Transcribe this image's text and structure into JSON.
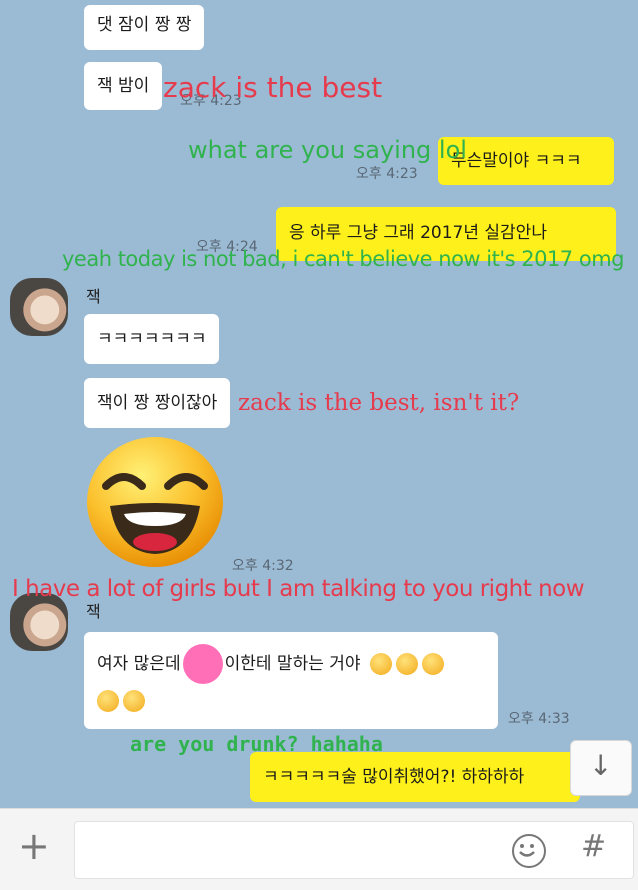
{
  "messages": [
    {
      "text": "댓 잠이 짱 짱"
    },
    {
      "text": "잭 밤이"
    },
    {
      "text": "무슨말이야 ㅋㅋㅋ"
    },
    {
      "text": "응 하루 그냥 그래 2017년 실감안나"
    },
    {
      "text": "ㅋㅋㅋㅋㅋㅋㅋ"
    },
    {
      "text": "잭이 짱 짱이잖아"
    },
    {
      "text_a": "여자 많은데",
      "text_b": "이한테 말하는 거야"
    },
    {
      "text": "ㅋㅋㅋㅋㅋ술 많이취했어?! 하하하하"
    }
  ],
  "timestamps": {
    "t1": "오후 4:23",
    "t2": "오후 4:23",
    "t3": "오후 4:24",
    "t4": "오후 4:32",
    "t5": "오후 4:33"
  },
  "sender_name": "잭",
  "overlays": {
    "o1": "zack is the best",
    "o2": "what are you saying lol",
    "o3": "yeah today is not bad, i can't believe now it's 2017 omg",
    "o4": "zack is the best, isn't it?",
    "o5": "I have a lot of girls but I am talking to you right now",
    "o6": "are you drunk? hahaha"
  },
  "input_bar": {
    "plus_icon": "+",
    "hash_icon": "#"
  },
  "scroll_down_icon": "↓",
  "colors": {
    "background": "#9bbbd4",
    "my_bubble": "#fef01b",
    "their_bubble": "#ffffff",
    "overlay_red": "#e63a4d",
    "overlay_green": "#30b34e"
  }
}
